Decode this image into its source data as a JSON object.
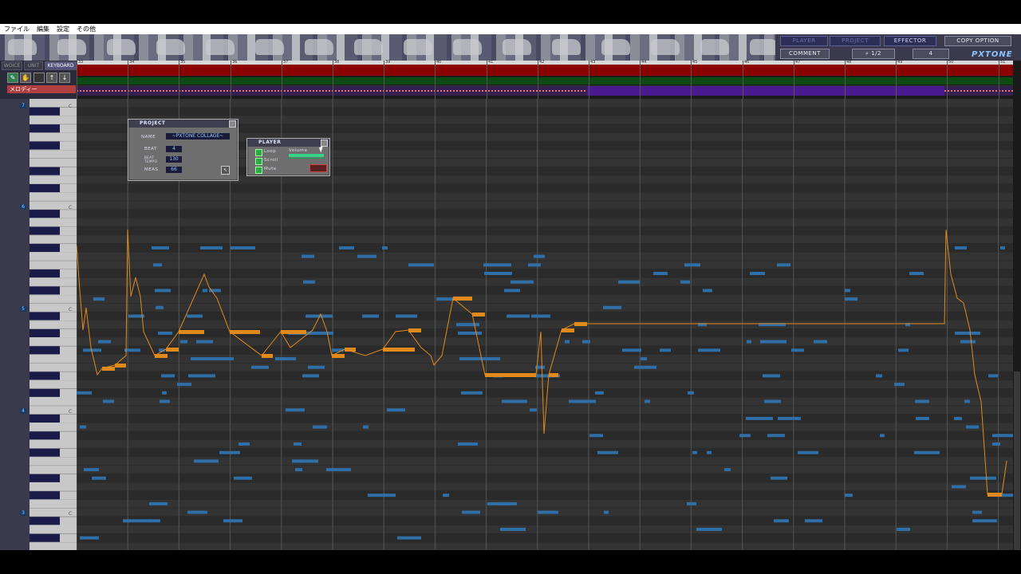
{
  "menu": [
    "ファイル",
    "編集",
    "設定",
    "その他"
  ],
  "header": {
    "buttons": {
      "player": "PLAYER",
      "project": "PROJECT",
      "effector": "EFFECTOR",
      "copy_option": "COPY OPTION",
      "comment": "COMMENT"
    },
    "zoom": "1/2",
    "division": "4",
    "logo": "PXTONE",
    "art_label": "PXTONE"
  },
  "tabs": [
    "WOICE",
    "UNIT",
    "KEYBOARD"
  ],
  "unit_name": "メロディー",
  "measures": [
    "33",
    "34",
    "35",
    "36",
    "37",
    "38",
    "39",
    "40",
    "41",
    "42",
    "43",
    "44",
    "45",
    "46",
    "47",
    "48",
    "49",
    "50",
    "51"
  ],
  "octaves": [
    "7",
    "6",
    "5",
    "4",
    "3"
  ],
  "c_label": "C",
  "project_window": {
    "title": "PROJECT",
    "name_label": "NAME",
    "name_value": "~PXTONE COLLAGE~",
    "beat_label": "BEAT",
    "beat_value": "4",
    "tempo_label": "BEAT TEMPO",
    "tempo_value": "130",
    "meas_label": "MEAS",
    "meas_value": "66"
  },
  "player_window": {
    "title": "PLAYER",
    "loop_label": "Loop",
    "scroll_label": "Scroll",
    "mute_label": "Mute",
    "volume_label": "Volume"
  },
  "colors": {
    "melody": "#e08a1e",
    "other_notes": "#2f6fa8",
    "lane_dark": "#2a2a2a",
    "lane_light": "#333333"
  }
}
